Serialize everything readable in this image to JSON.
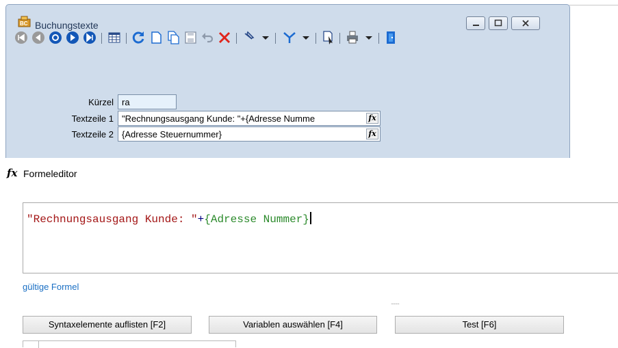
{
  "window": {
    "title": "Buchungstexte",
    "controls": [
      "minimize",
      "maximize",
      "close"
    ]
  },
  "toolbar": {
    "icons": [
      "first-record-icon",
      "previous-record-icon",
      "scroll-icon",
      "next-record-icon",
      "last-record-icon",
      "table-view-icon",
      "refresh-icon",
      "new-document-icon",
      "copy-document-icon",
      "save-icon",
      "undo-icon",
      "delete-icon",
      "pin-icon",
      "filter-icon",
      "document-pointer-icon",
      "print-icon",
      "exit-icon"
    ]
  },
  "form": {
    "kuerzel": {
      "label": "Kürzel",
      "value": "ra"
    },
    "textzeile1": {
      "label": "Textzeile 1",
      "value": "\"Rechnungsausgang Kunde: \"+{Adresse Numme"
    },
    "textzeile2": {
      "label": "Textzeile 2",
      "value": "{Adresse Steuernummer}"
    },
    "fx_label": "fx"
  },
  "formeleditor": {
    "icon": "fx",
    "title": "Formeleditor",
    "formula": {
      "string_part": "\"Rechnungsausgang Kunde: \"",
      "operator": "+",
      "variable": "{Adresse Nummer}"
    },
    "status": "gültige Formel",
    "grip": "........",
    "buttons": {
      "syntax": "Syntaxelemente auflisten [F2]",
      "variables": "Variablen auswählen [F4]",
      "test": "Test [F6]"
    }
  },
  "colors": {
    "window_bg": "#cfdceb",
    "string": "#a31515",
    "variable": "#2b8a2b",
    "status": "#1a6fc4",
    "delete": "#e0241b"
  }
}
